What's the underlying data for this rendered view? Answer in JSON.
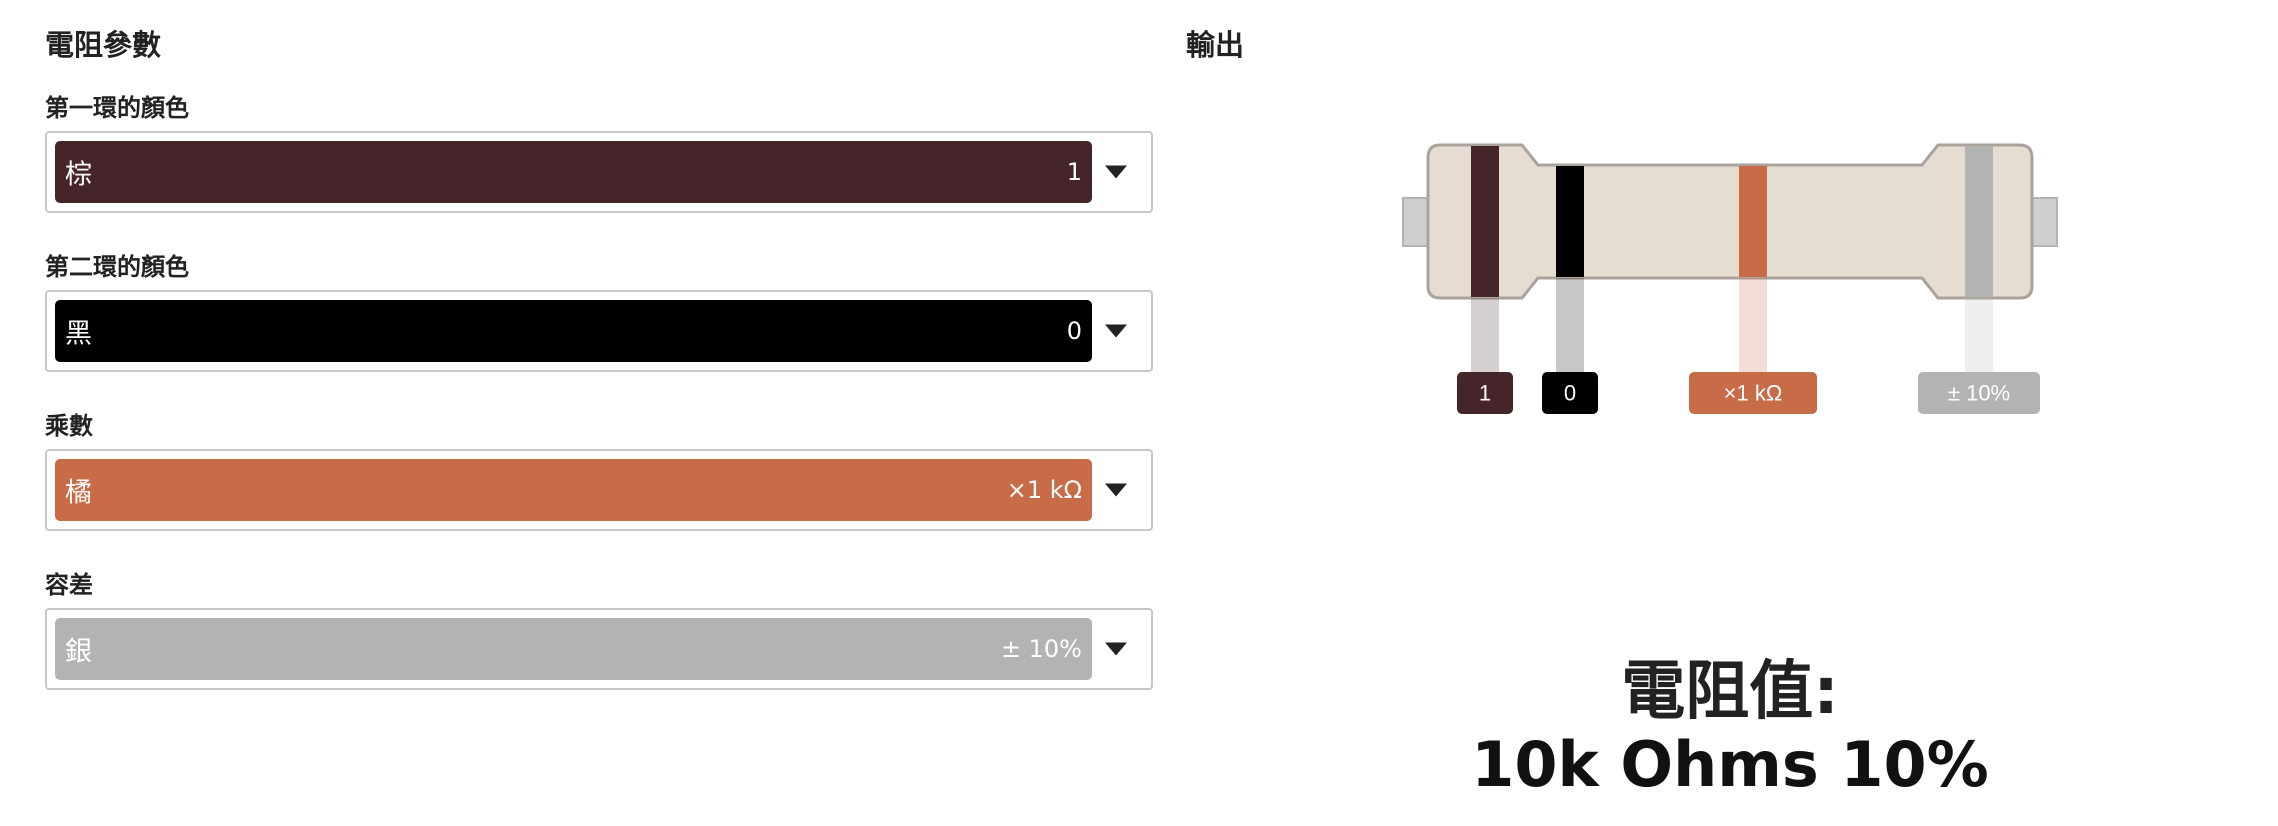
{
  "params": {
    "title": "電阻參數",
    "fields": [
      {
        "label": "第一環的顏色",
        "name": "棕",
        "value": "1",
        "color": "#45252a",
        "text_color": "#ffffff"
      },
      {
        "label": "第二環的顏色",
        "name": "黑",
        "value": "0",
        "color": "#000000",
        "text_color": "#ffffff"
      },
      {
        "label": "乘數",
        "name": "橘",
        "value": "×1 kΩ",
        "color": "#c86b47",
        "text_color": "#ffffff"
      },
      {
        "label": "容差",
        "name": "銀",
        "value": "± 10%",
        "color": "#b3b3b3",
        "text_color": "#ffffff"
      }
    ]
  },
  "output": {
    "title": "輸出",
    "bands": [
      {
        "tag": "1",
        "color": "#45252a"
      },
      {
        "tag": "0",
        "color": "#000000"
      },
      {
        "tag": "×1 kΩ",
        "color": "#c86b47"
      },
      {
        "tag": "± 10%",
        "color": "#b3b3b3"
      }
    ],
    "body_color": "#e5ddd2",
    "result_label": "電阻值:",
    "result_value": "10k Ohms 10%"
  }
}
